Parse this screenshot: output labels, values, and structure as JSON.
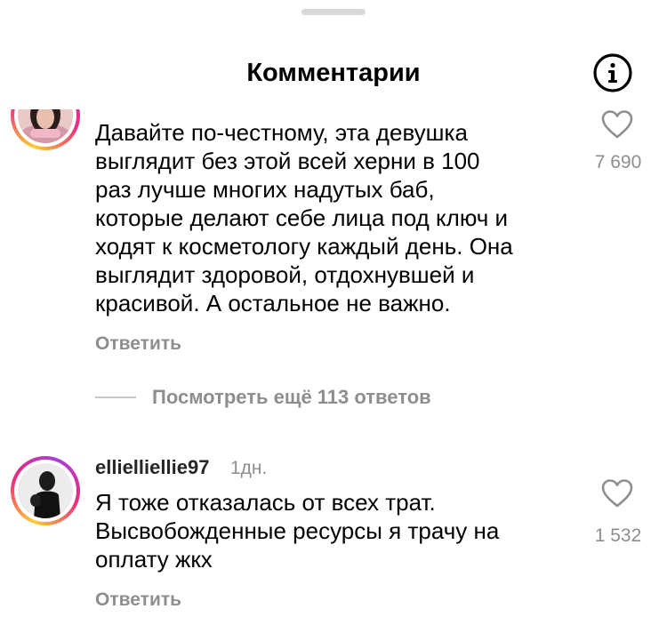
{
  "header": {
    "title": "Комментарии"
  },
  "comments": [
    {
      "text": "Давайте по-честному, эта девушка\nвыглядит без этой всей херни в 100\nраз лучше многих надутых баб,\nкоторые делают себе лица под ключ и\nходят к косметологу каждый день. Она\nвыглядит здоровой, отдохнувшей и\nкрасивой. А остальное не важно.",
      "likes": "7 690",
      "reply_label": "Ответить",
      "view_replies_label": "Посмотреть ещё 113 ответов"
    },
    {
      "username": "ellielliellie97",
      "time": "1дн.",
      "text": "Я тоже отказалась от всех трат.\nВысвобожденные ресурсы я трачу на\nоплату жкх",
      "likes": "1 532",
      "reply_label": "Ответить"
    }
  ],
  "colors": {
    "primary_text": "#000000",
    "secondary_text": "#8e8e8e",
    "story_ring_start": "#f9ce34",
    "story_ring_mid": "#ee2a7b",
    "story_ring_end": "#a63fd9"
  },
  "icons": {
    "info": "info-icon",
    "like": "heart-icon"
  }
}
